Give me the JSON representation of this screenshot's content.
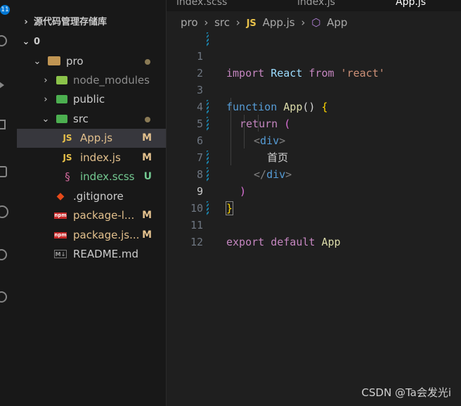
{
  "activity_bar": {
    "badge": "11",
    "icons": [
      "search-icon",
      "source-control-icon",
      "run-debug-icon",
      "extensions-icon",
      "remote-icon",
      "github-icon",
      "account-icon",
      "accounts-icon"
    ]
  },
  "explorer": {
    "top_section": "源代码管理存储库",
    "root": "0",
    "items": [
      {
        "label": "pro",
        "status": "●"
      },
      {
        "label": "node_modules",
        "status": ""
      },
      {
        "label": "public",
        "status": ""
      },
      {
        "label": "src",
        "status": "●"
      },
      {
        "label": "App.js",
        "status": "M",
        "icon": "JS"
      },
      {
        "label": "index.js",
        "status": "M",
        "icon": "JS"
      },
      {
        "label": "index.scss",
        "status": "U",
        "icon": "§"
      },
      {
        "label": ".gitignore",
        "status": "",
        "icon": "◆"
      },
      {
        "label": "package-l...",
        "status": "M",
        "icon": "npm"
      },
      {
        "label": "package.js...",
        "status": "M",
        "icon": "npm"
      },
      {
        "label": "README.md",
        "status": "",
        "icon": "M↓"
      }
    ]
  },
  "tabs": [
    "index.scss",
    "index.js",
    "App.js"
  ],
  "breadcrumb": {
    "parts": [
      "pro",
      "src",
      "App.js",
      "App"
    ],
    "js_badge": "JS",
    "sep": "›"
  },
  "code": {
    "line_numbers": [
      "1",
      "2",
      "3",
      "4",
      "5",
      "6",
      "7",
      "8",
      "9",
      "10",
      "11",
      "12"
    ],
    "l1": {
      "a": "import",
      "b": " React ",
      "c": "from",
      "d": " 'react'"
    },
    "l3": {
      "a": "function",
      "b": " App",
      "c": "()",
      "d": " {"
    },
    "l4": {
      "a": "return",
      "b": " ("
    },
    "l5": {
      "a": "<",
      "b": "div",
      "c": ">"
    },
    "l6": {
      "a": "首页"
    },
    "l7": {
      "a": "</",
      "b": "div",
      "c": ">"
    },
    "l8": {
      "a": ")"
    },
    "l9": {
      "a": "}"
    },
    "l11": {
      "a": "export",
      "b": " default",
      "c": " App"
    }
  },
  "watermark": "CSDN @Ta会发光i",
  "colors": {
    "accent": "#0078d4",
    "modified": "#e2c08d",
    "untracked": "#73c991"
  }
}
